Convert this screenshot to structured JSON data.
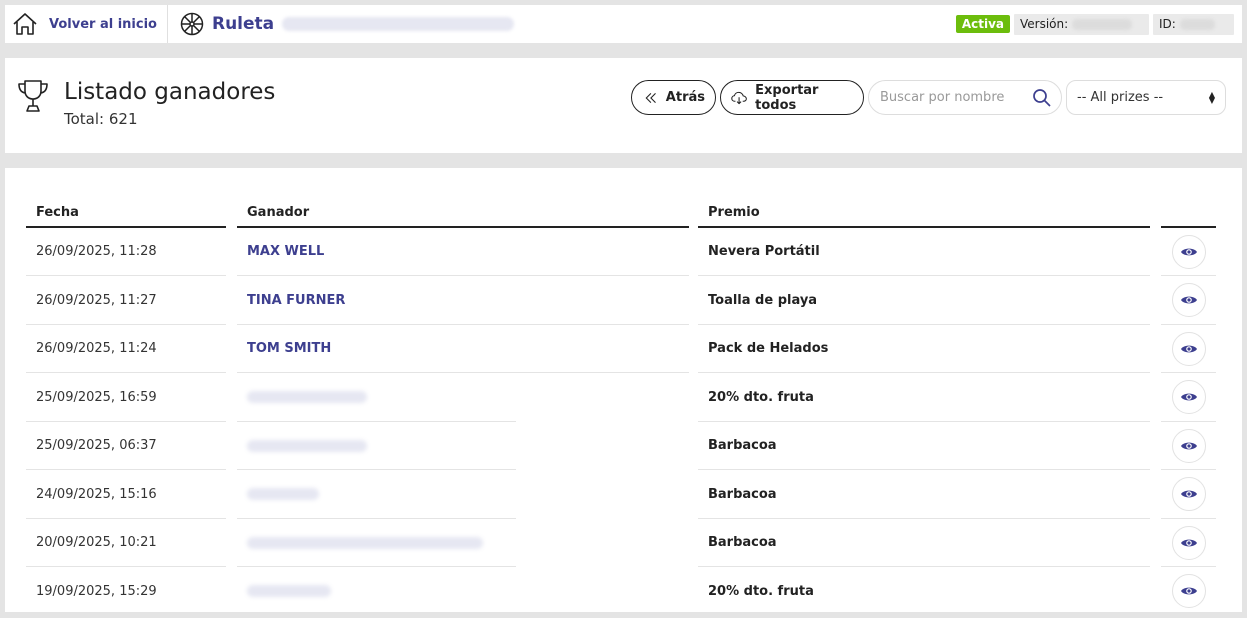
{
  "topbar": {
    "home_label": "Volver al inicio",
    "brand_name": "Ruleta",
    "status_badge": "Activa",
    "version_label": "Versión:",
    "id_label": "ID:"
  },
  "header": {
    "title": "Listado ganadores",
    "total": "Total: 621",
    "back_label": "Atrás",
    "export_label": "Exportar todos",
    "search_placeholder": "Buscar por nombre",
    "prize_filter_selected": "-- All prizes --"
  },
  "table": {
    "columns": [
      "Fecha",
      "Ganador",
      "Premio",
      ""
    ],
    "rows": [
      {
        "date": "26/09/2025, 11:28",
        "winner": "MAX WELL",
        "prize": "Nevera Portátil"
      },
      {
        "date": "26/09/2025, 11:27",
        "winner": "TINA FURNER",
        "prize": "Toalla de playa"
      },
      {
        "date": "26/09/2025, 11:24",
        "winner": "TOM SMITH",
        "prize": "Pack de Helados"
      },
      {
        "date": "25/09/2025, 16:59",
        "winner": "",
        "prize": "20% dto. fruta"
      },
      {
        "date": "25/09/2025, 06:37",
        "winner": "",
        "prize": "Barbacoa"
      },
      {
        "date": "24/09/2025, 15:16",
        "winner": "",
        "prize": "Barbacoa"
      },
      {
        "date": "20/09/2025, 10:21",
        "winner": "",
        "prize": "Barbacoa"
      },
      {
        "date": "19/09/2025, 15:29",
        "winner": "",
        "prize": "20% dto. fruta"
      }
    ]
  },
  "colors": {
    "accent": "#3d3f8f",
    "active_badge": "#6cbd0c"
  },
  "icons": {
    "home": "home-icon",
    "brand": "wheel-icon",
    "title": "trophy-icon",
    "back": "double-chevron-left-icon",
    "export": "cloud-download-icon",
    "search": "search-icon",
    "row_action": "eye-icon"
  }
}
